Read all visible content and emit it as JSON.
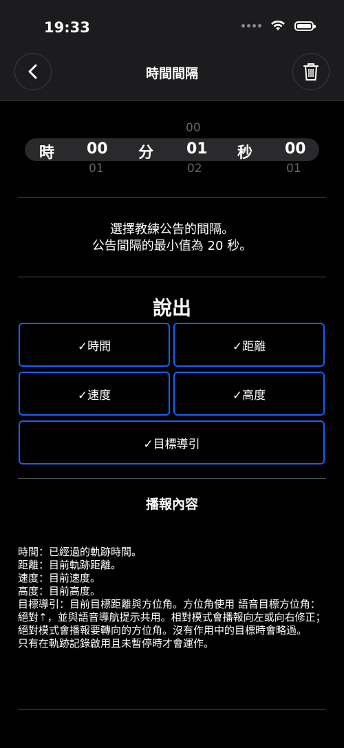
{
  "status": {
    "time": "19:33"
  },
  "nav": {
    "title": "時間間隔"
  },
  "picker": {
    "hours_label": "時",
    "hours_value": "00",
    "hours_below": "01",
    "minutes_label": "分",
    "minutes_above": "00",
    "minutes_value": "01",
    "minutes_below": "02",
    "seconds_label": "秒",
    "seconds_value": "00",
    "seconds_below": "01"
  },
  "description": {
    "line1": "選擇教練公告的間隔。",
    "line2": "公告間隔的最小值為 20 秒。"
  },
  "say": {
    "title": "說出",
    "options": [
      {
        "label": "✓時間",
        "checked": true
      },
      {
        "label": "✓距離",
        "checked": true
      },
      {
        "label": "✓速度",
        "checked": true
      },
      {
        "label": "✓高度",
        "checked": true
      },
      {
        "label": "✓目標導引",
        "checked": true
      }
    ]
  },
  "content": {
    "title": "播報內容",
    "lines": [
      "時間：已經過的軌跡時間。",
      "距離：目前軌跡距離。",
      "速度：目前速度。",
      "高度：目前高度。",
      "目標導引：目前目標距離與方位角。方位角使用 語音目標方位角：絕對⇡，並與語音導航提示共用。相對模式會播報向左或向右修正；絕對模式會播報要轉向的方位角。沒有作用中的目標時會略過。",
      "只有在軌跡記錄啟用且未暫停時才會運作。"
    ]
  },
  "colors": {
    "accent": "#1560ff",
    "background": "#000000",
    "bar": "#1c1c1e"
  }
}
